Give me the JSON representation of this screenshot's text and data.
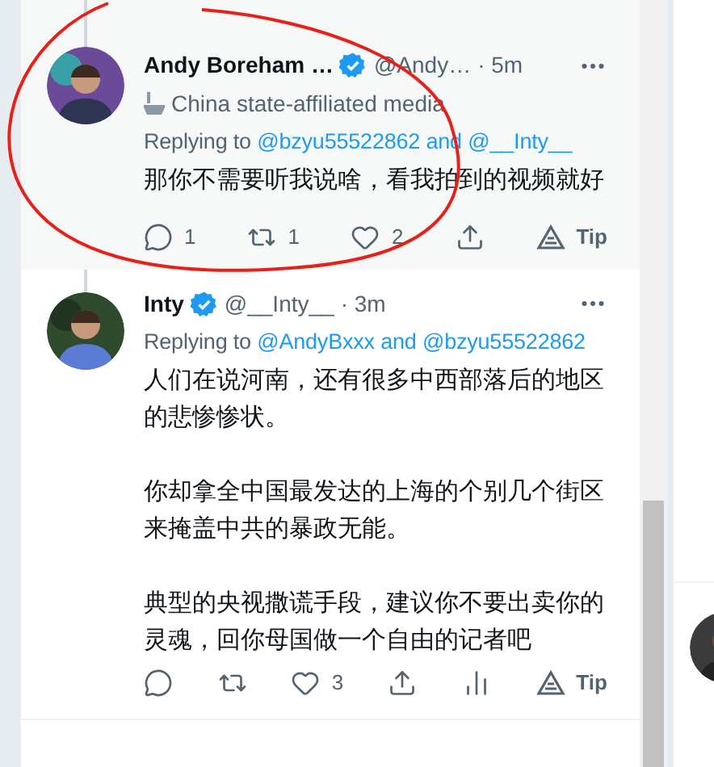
{
  "tweets": [
    {
      "author": "Andy Boreham …",
      "verified": true,
      "handle": "@Andy…",
      "time": "· 5m",
      "label": "China state-affiliated media",
      "replying_prefix": "Replying to",
      "replying_to": "@bzyu55522862 and @__Inty__",
      "paragraphs": [
        "那你不需要听我说啥，看我拍到的视频就好"
      ],
      "highlighted": true,
      "thread_above": true,
      "actions": [
        {
          "kind": "reply",
          "count": "1"
        },
        {
          "kind": "retweet",
          "count": "1"
        },
        {
          "kind": "like",
          "count": "2"
        },
        {
          "kind": "share"
        },
        {
          "kind": "tip",
          "label": "Tip"
        }
      ]
    },
    {
      "author": "Inty",
      "verified": true,
      "handle": "@__Inty__",
      "time": "· 3m",
      "replying_prefix": "Replying to",
      "replying_to": "@AndyBxxx and @bzyu55522862",
      "paragraphs": [
        "人们在说河南，还有很多中西部落后的地区的悲惨惨状。",
        "你却拿全中国最发达的上海的个别几个街区来掩盖中共的暴政无能。",
        "典型的央视撒谎手段，建议你不要出卖你的灵魂，回你母国做一个自由的记者吧"
      ],
      "highlighted": false,
      "thread_above": true,
      "actions": [
        {
          "kind": "reply"
        },
        {
          "kind": "retweet"
        },
        {
          "kind": "like",
          "count": "3"
        },
        {
          "kind": "share"
        },
        {
          "kind": "analytics"
        },
        {
          "kind": "tip",
          "label": "Tip"
        }
      ]
    }
  ]
}
